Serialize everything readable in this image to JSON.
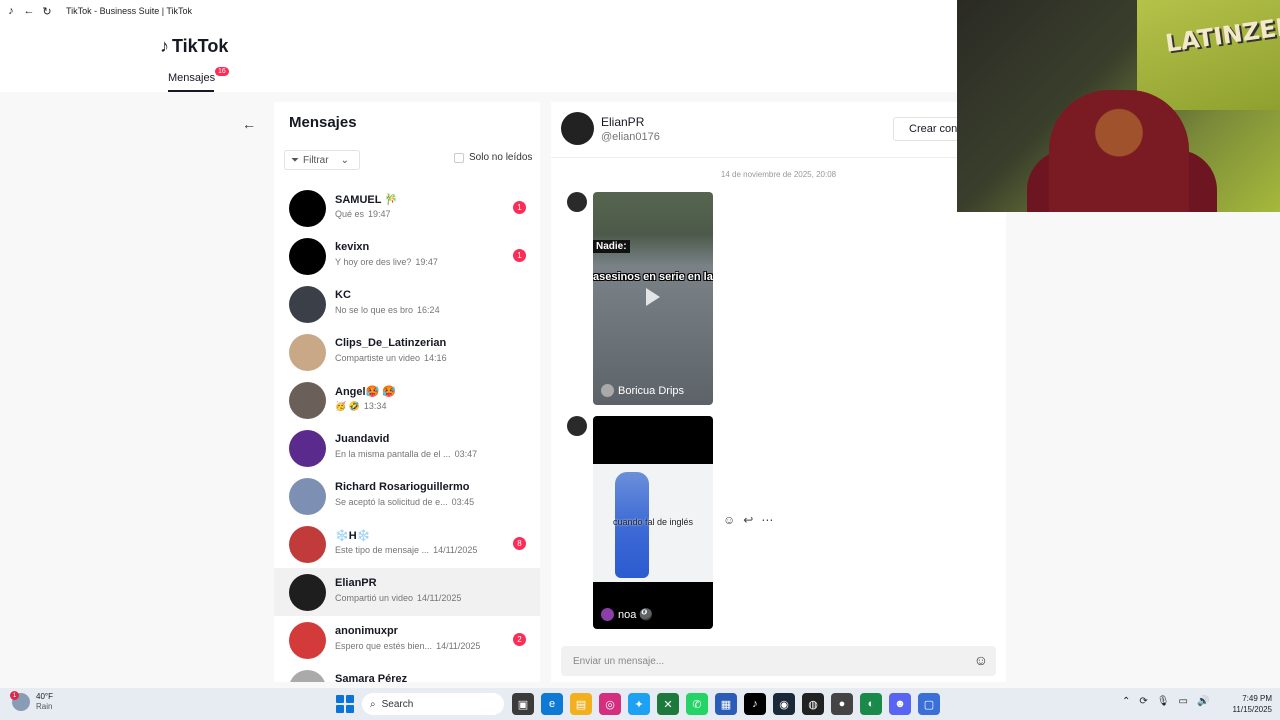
{
  "window": {
    "title": "TikTok - Business Suite | TikTok"
  },
  "header": {
    "logo": "TikTok",
    "tab_label": "Mensajes",
    "tab_badge": "16"
  },
  "list": {
    "title": "Mensajes",
    "filter_label": "Filtrar",
    "unread_label": "Solo no leídos",
    "conversations": [
      {
        "name": "SAMUEL 🎋",
        "preview": "Qué es",
        "time": "19:47",
        "badge": "1",
        "avatar_color": "#000000"
      },
      {
        "name": "kevixn",
        "preview": "Y hoy ore des live?",
        "time": "19:47",
        "badge": "1",
        "avatar_color": "#000000"
      },
      {
        "name": "KC",
        "preview": "No se lo que es bro",
        "time": "16:24",
        "badge": "",
        "avatar_color": "#3b4048"
      },
      {
        "name": "Clips_De_Latinzerian",
        "preview": "Compartiste un video",
        "time": "14:16",
        "badge": "",
        "avatar_color": "#c9a887"
      },
      {
        "name": "Angel🥵 🥵",
        "preview": "🥳 🤣",
        "time": "13:34",
        "badge": "",
        "avatar_color": "#6b5f59"
      },
      {
        "name": "Juandavid",
        "preview": "En la misma pantalla de el ...",
        "time": "03:47",
        "badge": "",
        "avatar_color": "#5a2a8c"
      },
      {
        "name": "Richard Rosarioguillermo",
        "preview": "Se aceptó la solicitud de e...",
        "time": "03:45",
        "badge": "",
        "avatar_color": "#7d8fb3"
      },
      {
        "name": "❄️H❄️",
        "preview": "Este tipo de mensaje ...",
        "time": "14/11/2025",
        "badge": "8",
        "avatar_color": "#c23b3b"
      },
      {
        "name": "ElianPR",
        "preview": "Compartió un video",
        "time": "14/11/2025",
        "badge": "",
        "avatar_color": "#1e1e1e"
      },
      {
        "name": "anonimuxpr",
        "preview": "Espero que estés bien...",
        "time": "14/11/2025",
        "badge": "2",
        "avatar_color": "#d33a3a"
      },
      {
        "name": "Samara Pérez",
        "preview": "",
        "time": "",
        "badge": "",
        "avatar_color": "#aaaaaa"
      }
    ]
  },
  "chat": {
    "name": "ElianPR",
    "handle": "@elian0176",
    "create_button": "Crear con",
    "timestamp": "14 de noviembre de 2025, 20:08",
    "video1": {
      "caption_top": "Nadie:",
      "caption_main": "asesinos en serie en las películas de terro",
      "owner": "Boricua Drips"
    },
    "video2": {
      "caption": "cuando fal    de inglés",
      "owner": "noa 🎱"
    },
    "composer_placeholder": "Enviar un mensaje..."
  },
  "taskbar": {
    "weather_temp": "40°F",
    "weather_cond": "Rain",
    "weather_badge": "1",
    "search_label": "Search",
    "time": "7:49 PM",
    "date": "11/15/2025"
  },
  "colors": {
    "accent": "#fe2c55",
    "taskbar": "#e6ecf2"
  }
}
